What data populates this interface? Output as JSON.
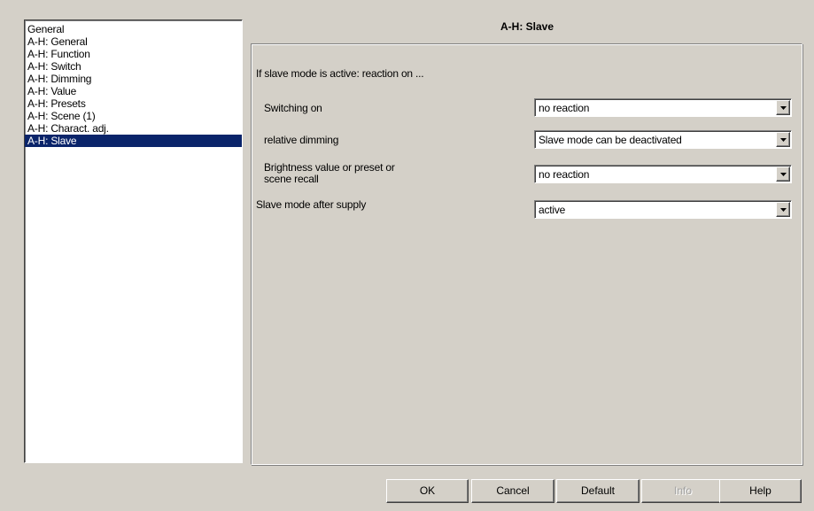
{
  "nav": {
    "items": [
      {
        "label": "General"
      },
      {
        "label": "A-H: General"
      },
      {
        "label": "A-H: Function"
      },
      {
        "label": "A-H: Switch"
      },
      {
        "label": "A-H: Dimming"
      },
      {
        "label": "A-H: Value"
      },
      {
        "label": "A-H: Presets"
      },
      {
        "label": "A-H: Scene (1)"
      },
      {
        "label": "A-H: Charact. adj."
      },
      {
        "label": "A-H: Slave"
      }
    ],
    "selected": "A-H: Slave"
  },
  "panel": {
    "title": "A-H: Slave",
    "section_title": "If slave mode is active: reaction on ...",
    "params": [
      {
        "label": "Switching on",
        "value": "no reaction"
      },
      {
        "label": "relative dimming",
        "value": "Slave mode can be deactivated"
      },
      {
        "label_line1": "Brightness value or preset or",
        "label_line2": "scene recall",
        "value": "no reaction"
      },
      {
        "label": "Slave mode after supply",
        "value": "active"
      }
    ]
  },
  "buttons": {
    "ok": "OK",
    "cancel": "Cancel",
    "default": "Default",
    "info": "Info",
    "help": "Help"
  },
  "icons": {
    "dropdown": "chevron-down-icon"
  }
}
